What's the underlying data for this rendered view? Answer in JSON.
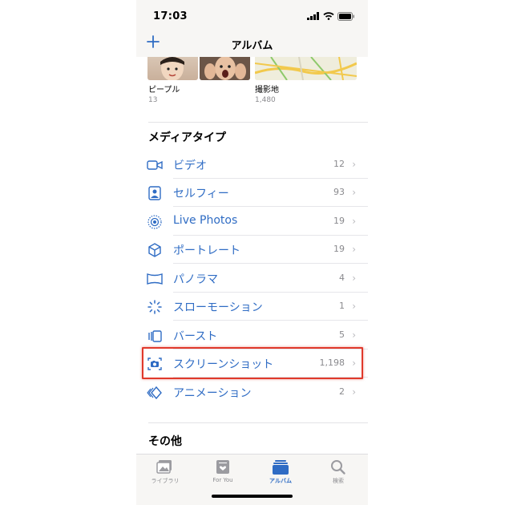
{
  "status": {
    "time": "17:03"
  },
  "nav": {
    "title": "アルバム",
    "add_icon": "plus-icon"
  },
  "albums": [
    {
      "label": "ピープル",
      "count": "13"
    },
    {
      "label": "撮影地",
      "count": "1,480"
    }
  ],
  "media_section": {
    "title": "メディアタイプ",
    "items": [
      {
        "label": "ビデオ",
        "count": "12",
        "icon": "video-icon"
      },
      {
        "label": "セルフィー",
        "count": "93",
        "icon": "selfie-icon"
      },
      {
        "label": "Live Photos",
        "count": "19",
        "icon": "live-photos-icon"
      },
      {
        "label": "ポートレート",
        "count": "19",
        "icon": "portrait-cube-icon"
      },
      {
        "label": "パノラマ",
        "count": "4",
        "icon": "panorama-icon"
      },
      {
        "label": "スローモーション",
        "count": "1",
        "icon": "slomo-icon"
      },
      {
        "label": "バースト",
        "count": "5",
        "icon": "burst-icon"
      },
      {
        "label": "スクリーンショット",
        "count": "1,198",
        "icon": "screenshot-icon"
      },
      {
        "label": "アニメーション",
        "count": "2",
        "icon": "animation-icon"
      }
    ]
  },
  "other_section": {
    "title": "その他"
  },
  "tabs": [
    {
      "label": "ライブラリ",
      "icon": "library-icon"
    },
    {
      "label": "For You",
      "icon": "for-you-icon"
    },
    {
      "label": "アルバム",
      "icon": "albums-icon",
      "active": true
    },
    {
      "label": "検索",
      "icon": "search-icon"
    }
  ],
  "colors": {
    "accent": "#2f6cc4",
    "highlight": "#e0392b",
    "secondary_text": "#8a8a8e"
  }
}
